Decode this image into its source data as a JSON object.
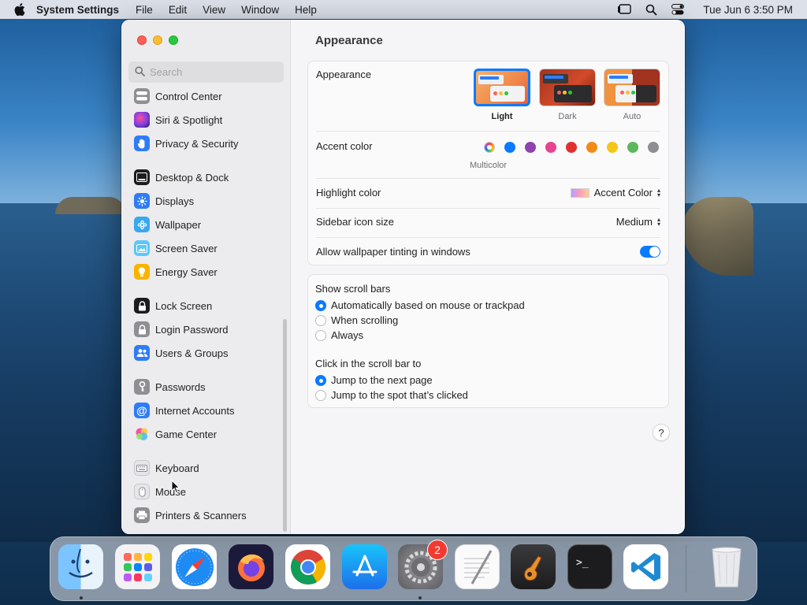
{
  "menubar": {
    "app_name": "System Settings",
    "items": [
      "File",
      "Edit",
      "View",
      "Window",
      "Help"
    ],
    "clock": "Tue Jun 6  3:50 PM"
  },
  "sidebar": {
    "search_placeholder": "Search",
    "items": [
      {
        "label": "Control Center",
        "icon": "control-center-icon",
        "color": "#8e8e93"
      },
      {
        "label": "Siri & Spotlight",
        "icon": "siri-icon",
        "color": "#7b3fe4"
      },
      {
        "label": "Privacy & Security",
        "icon": "hand-icon",
        "color": "#2f7cf6"
      },
      {
        "label": "Desktop & Dock",
        "icon": "desktop-dock-icon",
        "color": "#1c1c1e"
      },
      {
        "label": "Displays",
        "icon": "displays-icon",
        "color": "#2f7cf6"
      },
      {
        "label": "Wallpaper",
        "icon": "wallpaper-icon",
        "color": "#38a8f0"
      },
      {
        "label": "Screen Saver",
        "icon": "screen-saver-icon",
        "color": "#5ac8fa"
      },
      {
        "label": "Energy Saver",
        "icon": "energy-saver-icon",
        "color": "#f7b500"
      },
      {
        "label": "Lock Screen",
        "icon": "lock-icon",
        "color": "#1c1c1e"
      },
      {
        "label": "Login Password",
        "icon": "login-password-icon",
        "color": "#8e8e93"
      },
      {
        "label": "Users & Groups",
        "icon": "users-groups-icon",
        "color": "#2f7cf6"
      },
      {
        "label": "Passwords",
        "icon": "key-icon",
        "color": "#8e8e93"
      },
      {
        "label": "Internet Accounts",
        "icon": "at-icon",
        "color": "#2f7cf6"
      },
      {
        "label": "Game Center",
        "icon": "game-center-icon",
        "color": "#ffffff"
      },
      {
        "label": "Keyboard",
        "icon": "keyboard-icon",
        "color": "#d1d1d6"
      },
      {
        "label": "Mouse",
        "icon": "mouse-icon",
        "color": "#d1d1d6"
      },
      {
        "label": "Printers & Scanners",
        "icon": "printer-icon",
        "color": "#8e8e93"
      }
    ]
  },
  "content": {
    "title": "Appearance",
    "appearance": {
      "label": "Appearance",
      "options": [
        "Light",
        "Dark",
        "Auto"
      ],
      "selected": "Light"
    },
    "accent": {
      "label": "Accent color",
      "selected_name": "Multicolor",
      "colors": [
        "#0a7aff",
        "#8e44ad",
        "#e84393",
        "#e0312f",
        "#f38a16",
        "#f5c518",
        "#5cb85c",
        "#8e8e93"
      ]
    },
    "highlight": {
      "label": "Highlight color",
      "value": "Accent Color"
    },
    "icon_size": {
      "label": "Sidebar icon size",
      "value": "Medium"
    },
    "tinting": {
      "label": "Allow wallpaper tinting in windows",
      "enabled": true
    },
    "scroll_bars": {
      "label": "Show scroll bars",
      "options": [
        "Automatically based on mouse or trackpad",
        "When scrolling",
        "Always"
      ],
      "selected": 0
    },
    "click_scroll": {
      "label": "Click in the scroll bar to",
      "options": [
        "Jump to the next page",
        "Jump to the spot that’s clicked"
      ],
      "selected": 0
    },
    "help": "?"
  },
  "dock": {
    "apps": [
      "Finder",
      "Launchpad",
      "Safari",
      "Firefox",
      "Chrome",
      "App Store",
      "System Settings",
      "TextEdit",
      "GarageBand",
      "Terminal",
      "Visual Studio Code",
      "Trash"
    ],
    "badge": "2"
  }
}
